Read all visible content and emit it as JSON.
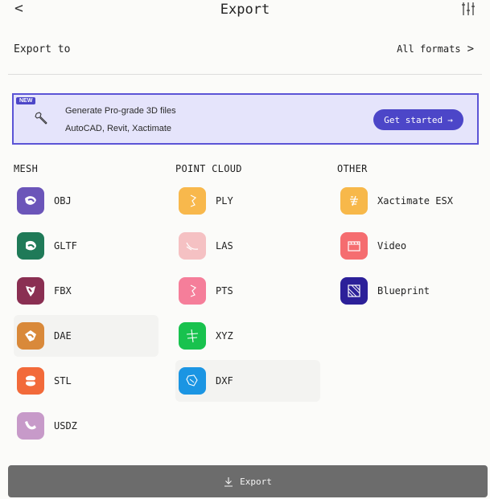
{
  "header": {
    "back": "<",
    "title": "Export",
    "settings_icon": "sliders-icon"
  },
  "export_to": {
    "label": "Export to",
    "value": "All formats",
    "chevron": ">"
  },
  "promo": {
    "badge": "NEW",
    "line1": "Generate Pro-grade 3D files",
    "line2": "AutoCAD, Revit, Xactimate",
    "cta": "Get started",
    "cta_arrow": "→",
    "icon": "wrench-icon",
    "accent": "#4c46c8",
    "background": "#e5e4fb"
  },
  "columns": {
    "mesh": {
      "heading": "MESH",
      "items": [
        {
          "label": "OBJ",
          "color": "#6b55b9",
          "icon": "obj-icon"
        },
        {
          "label": "GLTF",
          "color": "#1f7a58",
          "icon": "gltf-icon"
        },
        {
          "label": "FBX",
          "color": "#8a2f52",
          "icon": "fbx-icon"
        },
        {
          "label": "DAE",
          "color": "#d9893a",
          "icon": "dae-icon"
        },
        {
          "label": "STL",
          "color": "#f26a3a",
          "icon": "stl-icon"
        },
        {
          "label": "USDZ",
          "color": "#c79ac9",
          "icon": "usdz-icon"
        }
      ]
    },
    "point_cloud": {
      "heading": "POINT CLOUD",
      "items": [
        {
          "label": "PLY",
          "color": "#f8b84c",
          "icon": "ply-icon"
        },
        {
          "label": "LAS",
          "color": "#f5c1c3",
          "icon": "las-icon"
        },
        {
          "label": "PTS",
          "color": "#f57e9a",
          "icon": "pts-icon"
        },
        {
          "label": "XYZ",
          "color": "#18c24e",
          "icon": "xyz-icon"
        },
        {
          "label": "DXF",
          "color": "#1b95e3",
          "icon": "dxf-icon"
        }
      ]
    },
    "other": {
      "heading": "OTHER",
      "items": [
        {
          "label": "Xactimate ESX",
          "color": "#f7b84a",
          "icon": "xactimate-icon"
        },
        {
          "label": "Video",
          "color": "#f56d70",
          "icon": "video-icon"
        },
        {
          "label": "Blueprint",
          "color": "#2c2099",
          "icon": "blueprint-icon"
        }
      ]
    }
  },
  "footer": {
    "export_label": "Export",
    "icon": "download-icon"
  }
}
